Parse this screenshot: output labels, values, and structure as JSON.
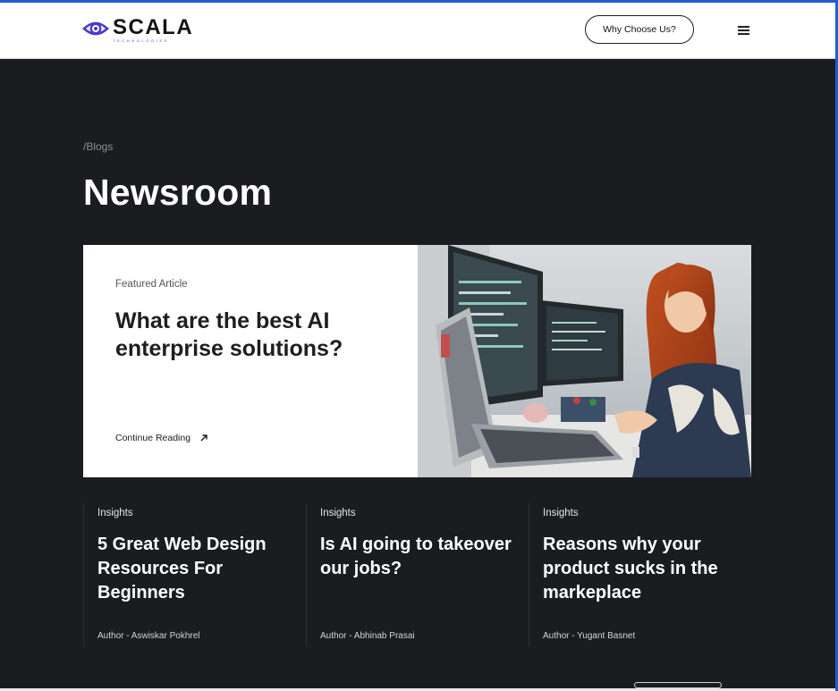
{
  "header": {
    "logo_text": "SCALA",
    "logo_subtext": "TECHNOLOGIES",
    "cta_label": "Why Choose Us?",
    "menu_icon": "hamburger-menu-icon"
  },
  "breadcrumb": "/Blogs",
  "page_title": "Newsroom",
  "featured": {
    "tag": "Featured Article",
    "title": "What are the best AI enterprise solutions?",
    "link_label": "Continue Reading",
    "link_icon": "arrow-up-right-icon",
    "image": "woman-working-at-computer-photo"
  },
  "articles": [
    {
      "tag": "Insights",
      "title": "5 Great Web Design Resources For Beginners",
      "author": "Author - Aswiskar Pokhrel"
    },
    {
      "tag": "Insights",
      "title": "Is AI going to takeover our jobs?",
      "author": "Author - Abhinab Prasai"
    },
    {
      "tag": "Insights",
      "title": "Reasons why your product sucks in the markeplace",
      "author": "Author - Yugant Basnet"
    }
  ],
  "colors": {
    "background": "#1b1c20",
    "brand_accent": "#4b3bd2",
    "frame": "#1d5fd1",
    "card_text": "#ffffff"
  }
}
